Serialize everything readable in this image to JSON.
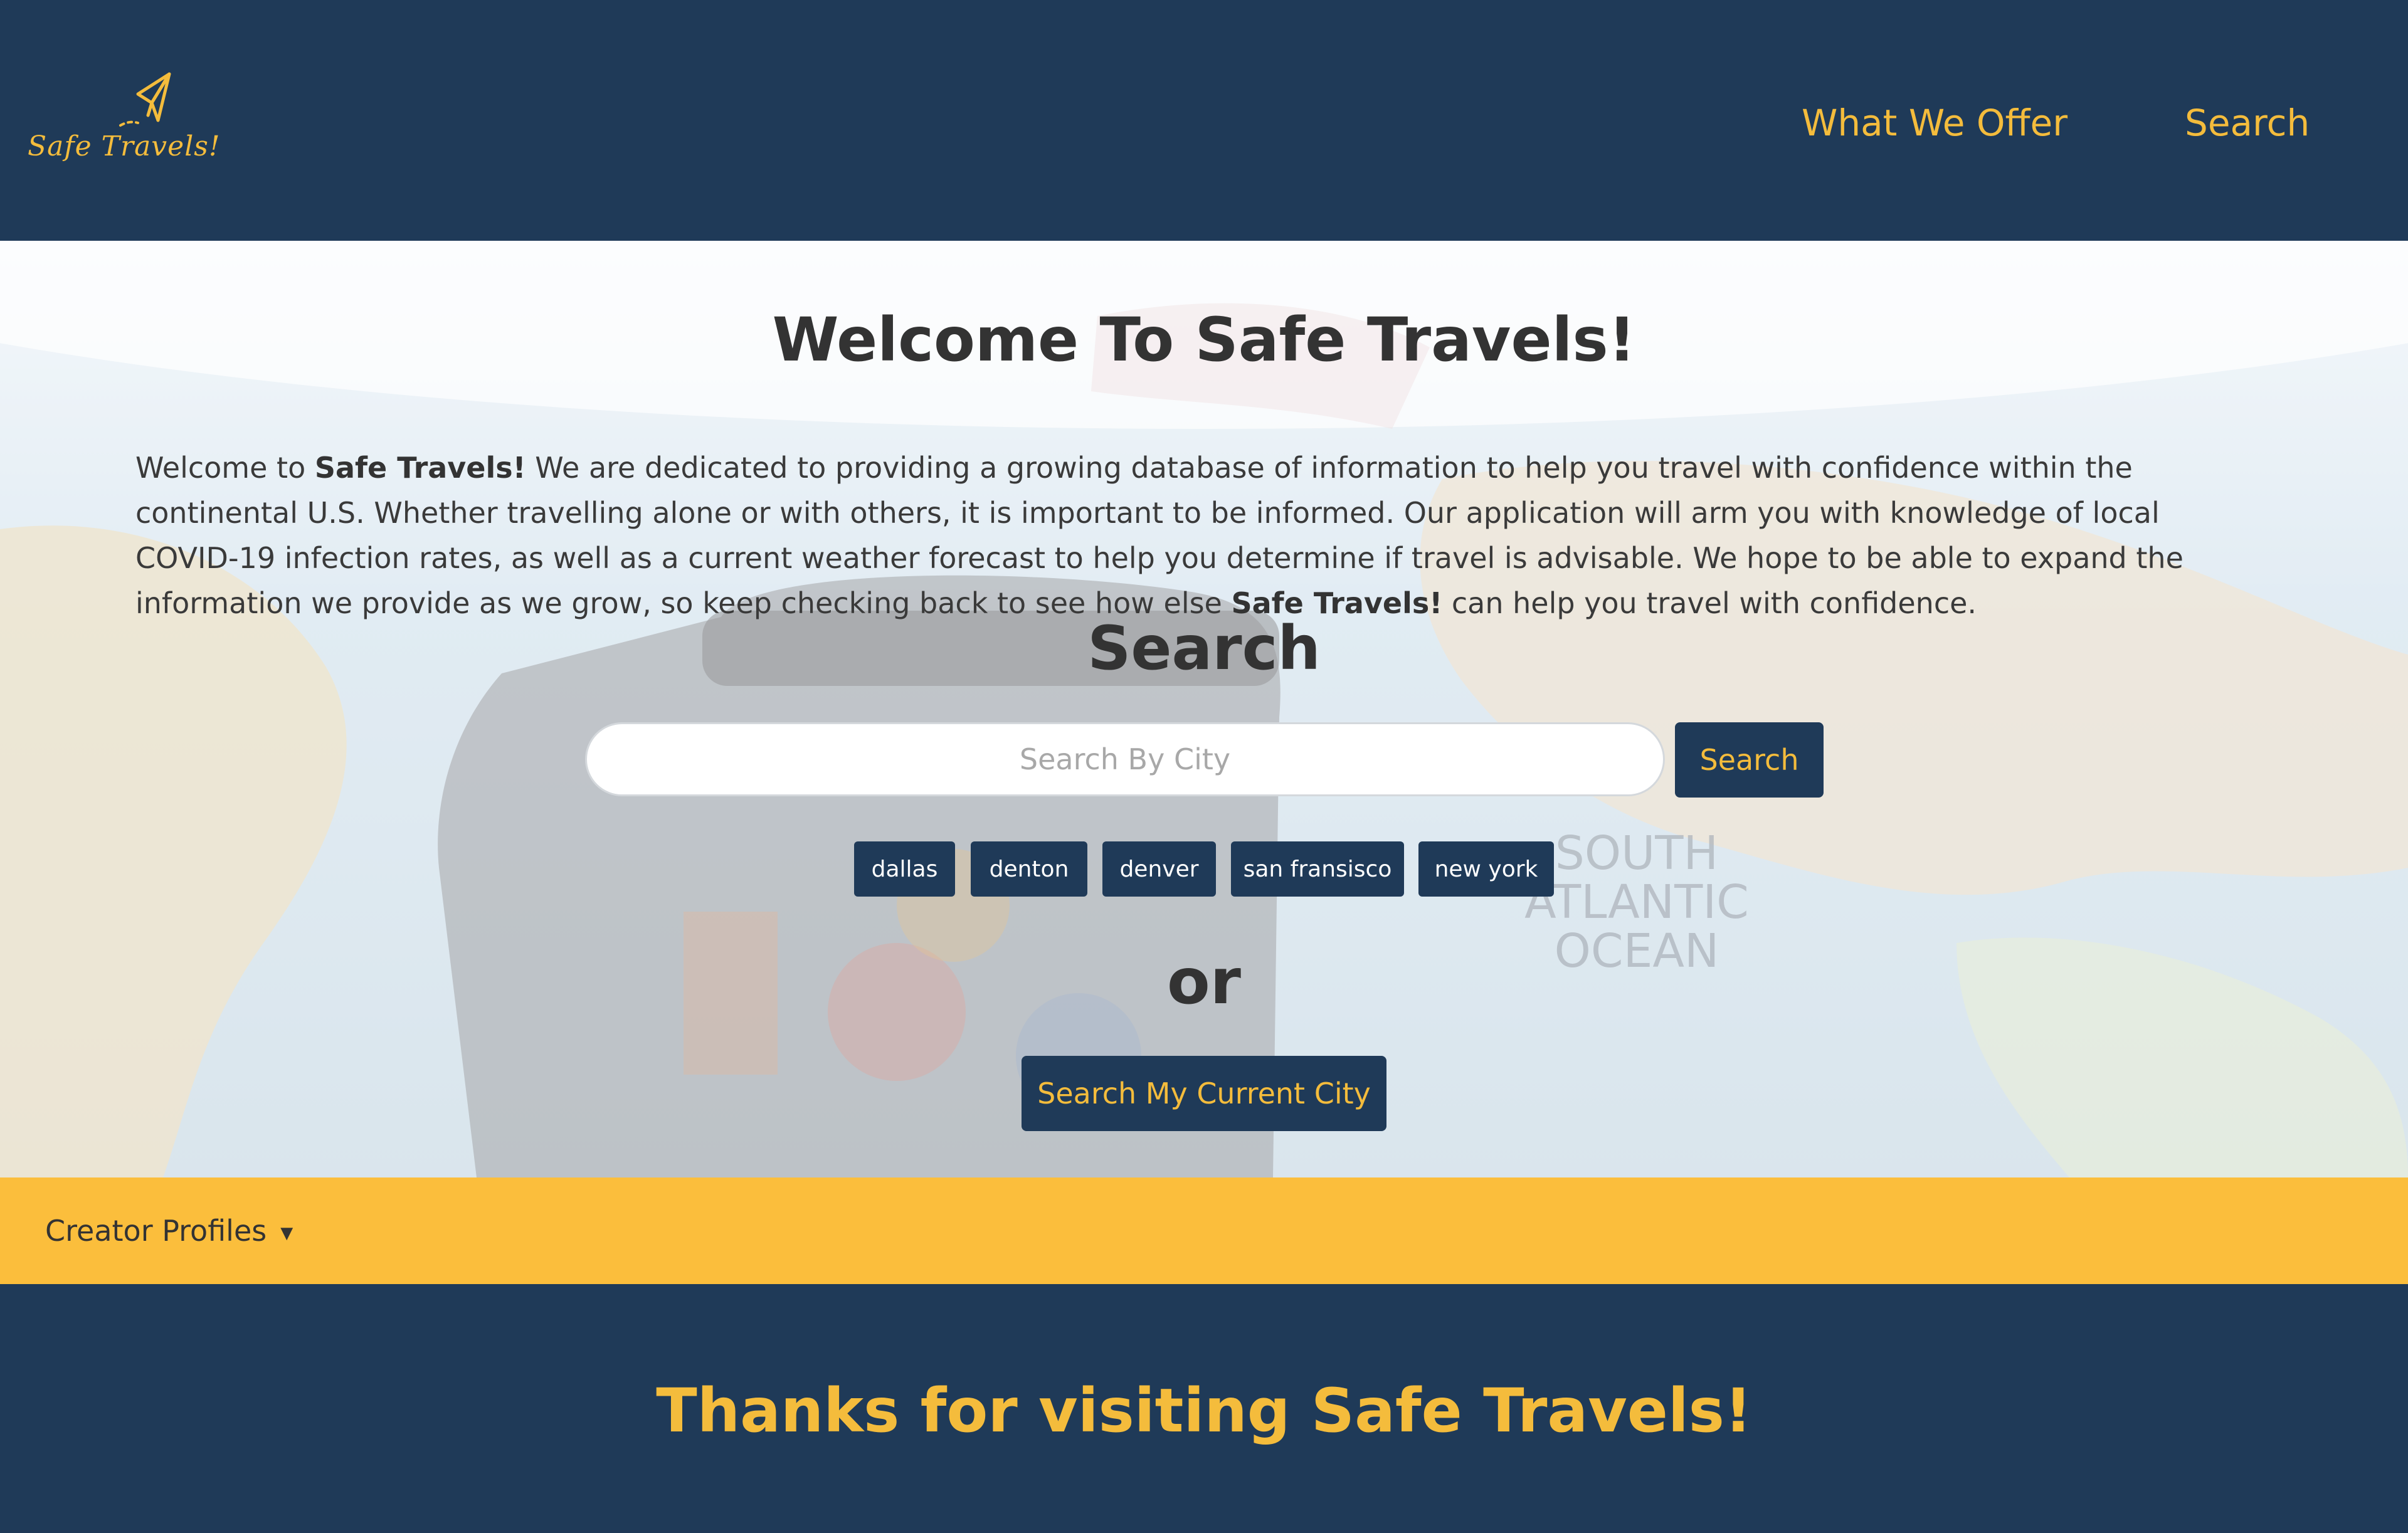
{
  "navbar": {
    "logo_text": "Safe Travels!",
    "links": [
      "What We Offer",
      "Search"
    ]
  },
  "hero": {
    "title": "Welcome To Safe Travels!",
    "intro": {
      "p1": "Welcome to ",
      "brand": "Safe Travels!",
      "p2": " We are dedicated to providing a growing database of information to help you travel with confidence within the continental U.S. Whether travelling alone or with others, it is important to be informed. Our application will arm you with knowledge of local COVID-19 infection rates, as well as a current weather forecast to help you determine if travel is advisable. We hope to be able to expand the information we provide as we grow, so keep checking back to see how else ",
      "p3": " can help you travel with confidence."
    },
    "map_labels": [
      "SOUTH",
      "ATLANTIC",
      "OCEAN"
    ]
  },
  "search": {
    "heading": "Search",
    "placeholder": "Search By City",
    "value": "",
    "button_label": "Search",
    "recent_cities": [
      "dallas",
      "denton",
      "denver",
      "san fransisco",
      "new york"
    ],
    "or_label": "or",
    "current_city_label": "Search My Current City"
  },
  "creators": {
    "label": "Creator Profiles",
    "caret": "▼"
  },
  "footer": {
    "text": "Thanks for visiting Safe Travels!"
  },
  "colors": {
    "navy": "#1f3a58",
    "gold": "#f4bc3c",
    "banner_yellow": "#fbbe3c",
    "text_dark": "#333333"
  },
  "icons": {
    "logo": "paper-plane-icon",
    "toggle": "caret-down-icon"
  }
}
